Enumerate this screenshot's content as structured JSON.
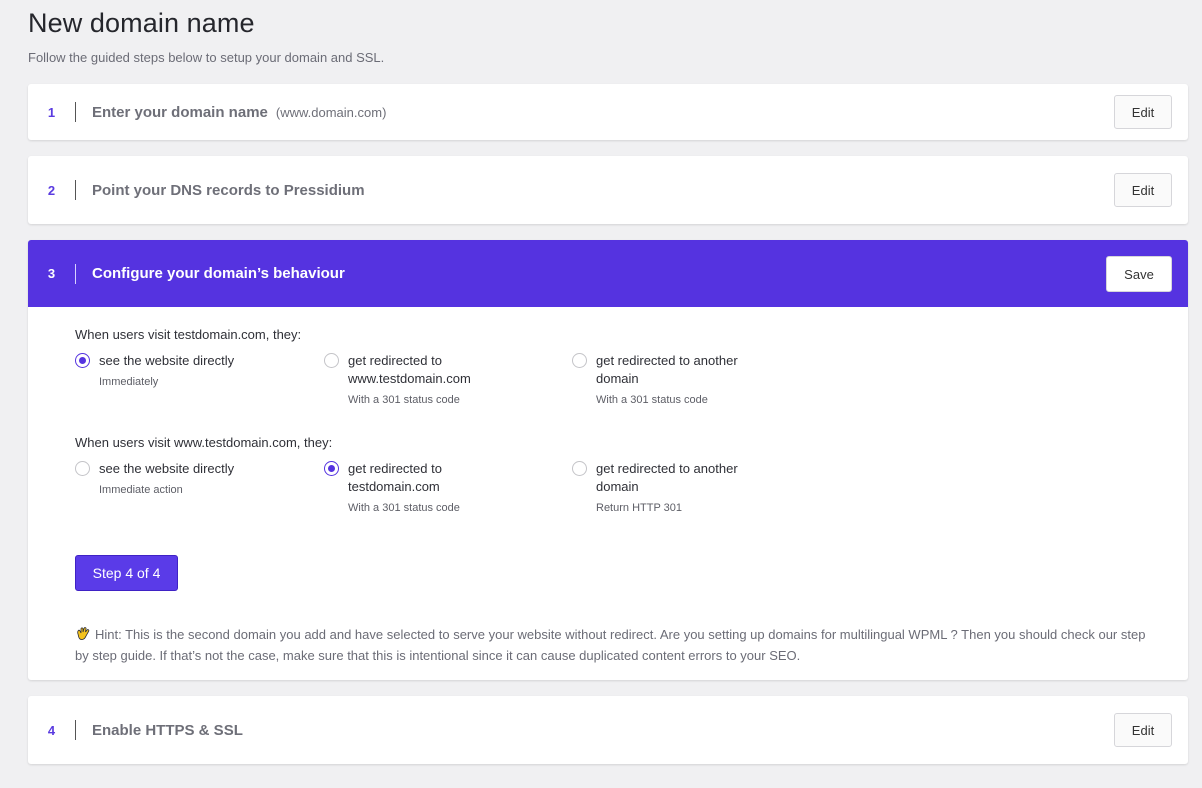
{
  "page": {
    "title": "New domain name",
    "subtitle": "Follow the guided steps below to setup your domain and SSL."
  },
  "steps": [
    {
      "number": "1",
      "title": "Enter your domain name",
      "hint": "(www.domain.com)",
      "button": "Edit"
    },
    {
      "number": "2",
      "title": "Point your DNS records to Pressidium",
      "button": "Edit"
    },
    {
      "number": "3",
      "title": "Configure your domain’s behaviour",
      "button": "Save"
    },
    {
      "number": "4",
      "title": "Enable HTTPS & SSL",
      "button": "Edit"
    }
  ],
  "behaviour": {
    "groups": [
      {
        "question": "When users visit testdomain.com, they:",
        "options": [
          {
            "label": "see the website directly",
            "sub": "Immediately",
            "checked": true
          },
          {
            "label": "get redirected to www.testdomain.com",
            "sub": "With a 301 status code",
            "checked": false
          },
          {
            "label": "get redirected to another domain",
            "sub": "With a 301 status code",
            "checked": false
          }
        ]
      },
      {
        "question": "When users visit www.testdomain.com, they:",
        "options": [
          {
            "label": "see the website directly",
            "sub": "Immediate action",
            "checked": false
          },
          {
            "label": "get redirected to testdomain.com",
            "sub": "With a 301 status code",
            "checked": true
          },
          {
            "label": "get redirected to another domain",
            "sub": "Return HTTP 301",
            "checked": false
          }
        ]
      }
    ],
    "progress_button": "Step 4 of 4",
    "hint": "Hint: This is the second domain you add and have selected to serve your website without redirect. Are you setting up domains for multilingual WPML ? Then you should check our step by step guide. If that’s not the case, make sure that this is intentional since it can cause duplicated content errors to your SEO."
  },
  "icons": {
    "hint": "waving-hand-icon"
  },
  "colors": {
    "accent": "#5533e0",
    "background": "#f0f0f2"
  }
}
